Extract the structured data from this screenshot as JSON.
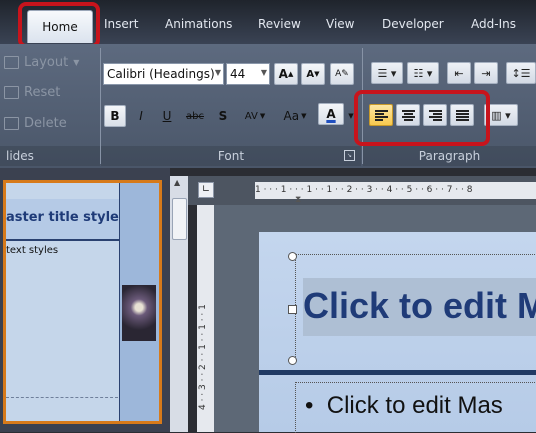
{
  "tabs": {
    "home": "Home",
    "insert": "Insert",
    "animations": "Animations",
    "review": "Review",
    "view": "View",
    "developer": "Developer",
    "addins": "Add-Ins"
  },
  "slides_group": {
    "layout": "Layout",
    "reset": "Reset",
    "delete": "Delete",
    "label": "lides"
  },
  "font_group": {
    "font_name": "Calibri (Headings)",
    "font_size": "44",
    "bold": "B",
    "italic": "I",
    "underline": "U",
    "strike": "abc",
    "shadow": "S",
    "spacing": "AV",
    "change_case": "Aa",
    "font_color": "A",
    "grow": "A",
    "shrink": "A",
    "label": "Font"
  },
  "paragraph_group": {
    "label": "Paragraph"
  },
  "thumbnail": {
    "title": "aster title style",
    "body": "text styles"
  },
  "ruler": {
    "horizontal": "1 · · · 1 · · · 1 · · 1 · · 2 · · 3 · · 4 · · 5 · · 6 · · 7 · · 8",
    "vertical": "4 · · 3 · · 2 · · 1 · · 1 · · 1"
  },
  "slide": {
    "title": "Click to edit M",
    "bullet": "Click to edit Mas"
  },
  "colors": {
    "highlight": "#c8141c",
    "title_text": "#1f3b78",
    "thumbnail_border": "#d77a1a"
  }
}
